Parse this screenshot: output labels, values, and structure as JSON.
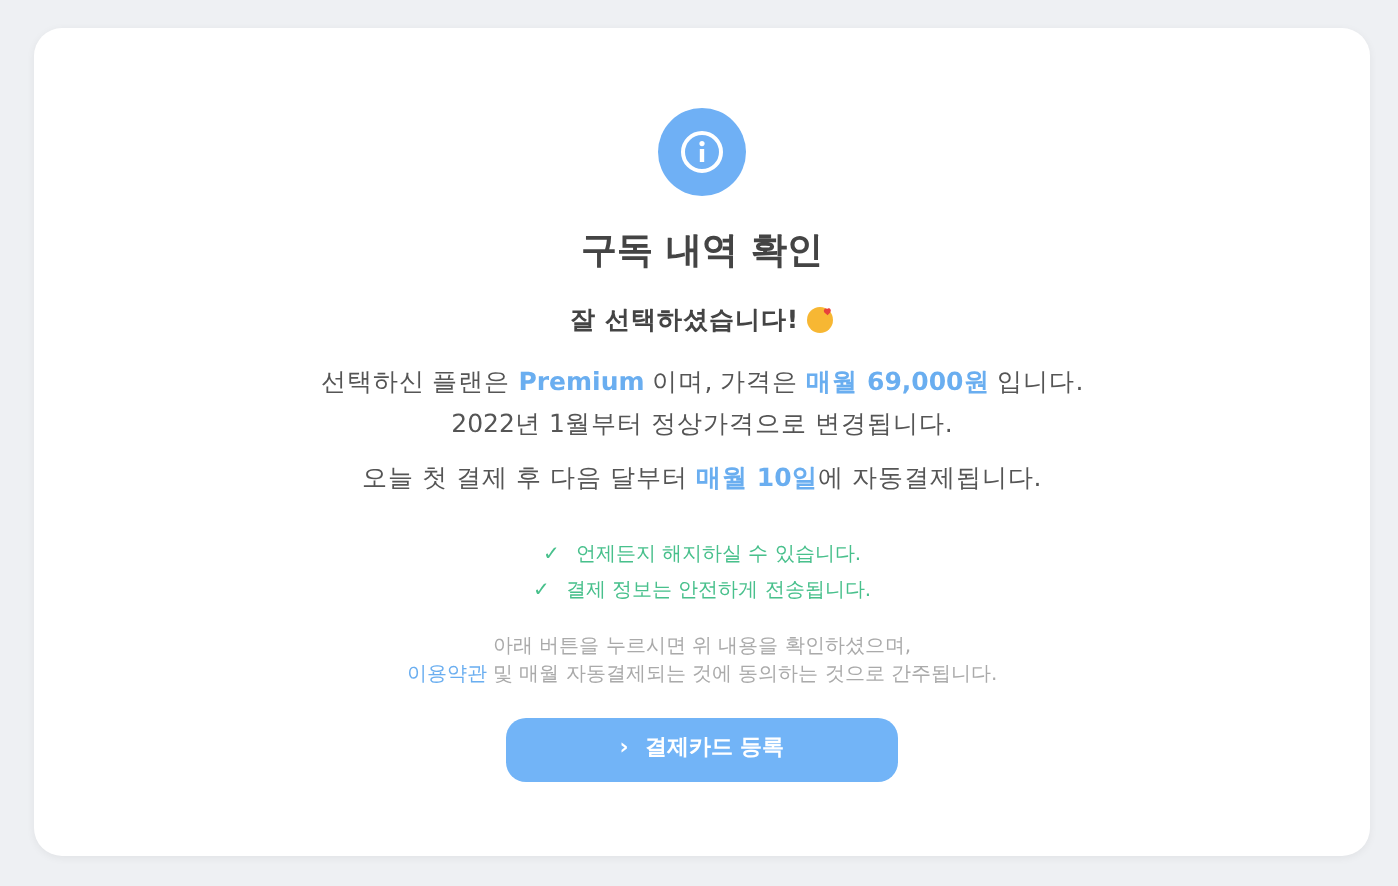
{
  "title": "구독 내역 확인",
  "greeting": "잘 선택하셨습니다!",
  "plan_lines": [
    [
      {
        "text": "선택하신 플랜은 ",
        "highlight": false
      },
      {
        "text": "Premium",
        "highlight": true
      },
      {
        "text": " 이며, 가격은 ",
        "highlight": false
      },
      {
        "text": "매월 69,000원",
        "highlight": true
      },
      {
        "text": " 입니다.",
        "highlight": false
      }
    ],
    [
      {
        "text": "2022년 1월부터 정상가격으로 변경됩니다.",
        "highlight": false
      }
    ]
  ],
  "billing_line": [
    {
      "text": "오늘 첫 결제 후 다음 달부터 ",
      "highlight": false
    },
    {
      "text": "매월 10일",
      "highlight": true
    },
    {
      "text": "에 자동결제됩니다.",
      "highlight": false
    }
  ],
  "benefits": [
    {
      "icon": "✓",
      "text": "언제든지 해지하실 수 있습니다."
    },
    {
      "icon": "✓",
      "text": "결제 정보는 안전하게 전송됩니다."
    }
  ],
  "notice": {
    "line_1": "아래 버튼을 누르시면 위 내용을 확인하셨으며,",
    "link": "이용약관",
    "line_2_rest": " 및 매월 자동결제되는 것에 동의하는 것으로 간주됩니다."
  },
  "button": {
    "icon": "›",
    "label": "결제카드 등록"
  }
}
